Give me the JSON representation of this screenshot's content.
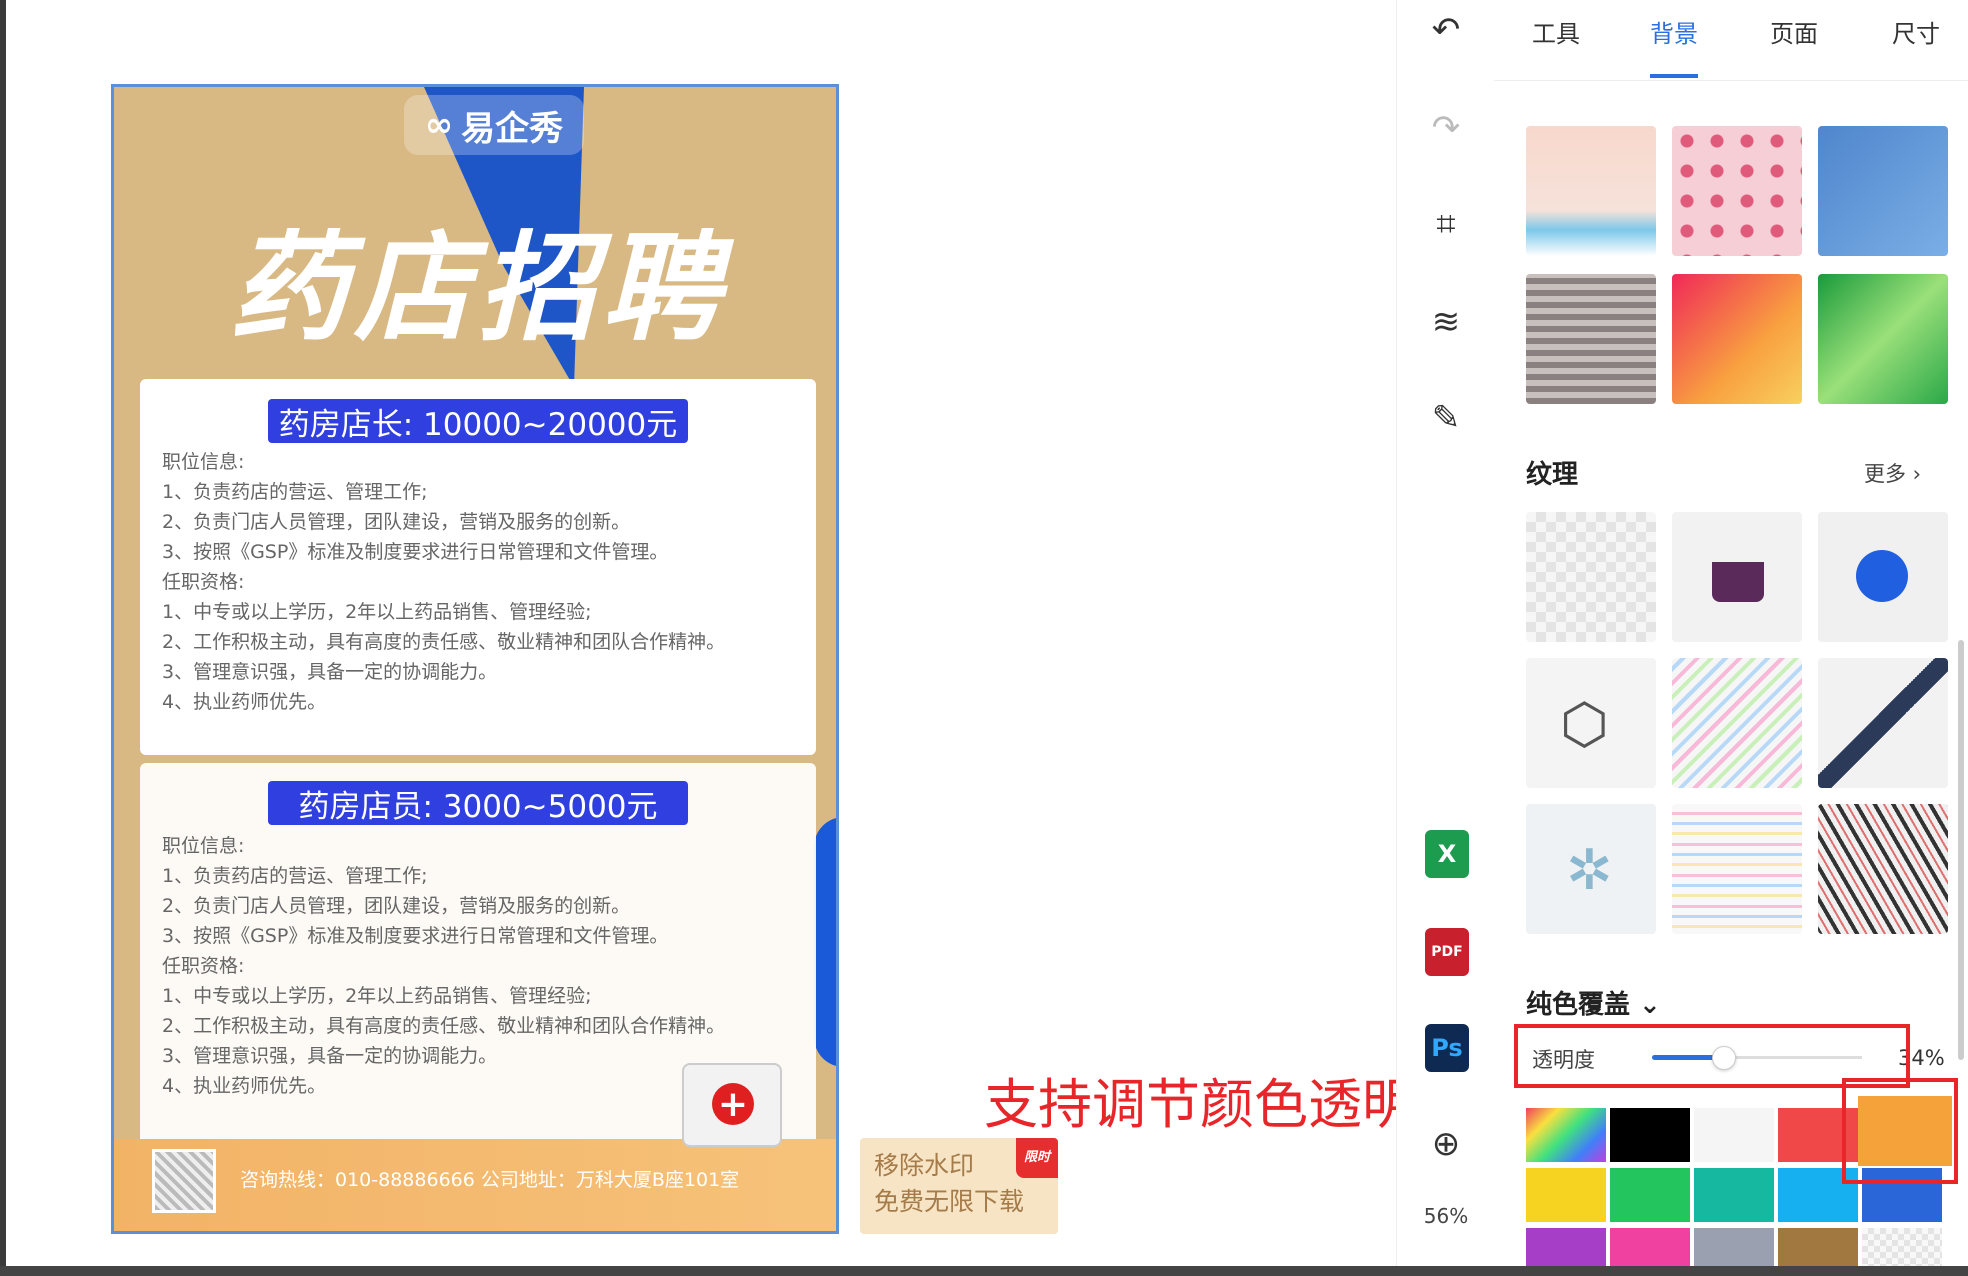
{
  "poster": {
    "logo_text": "易企秀",
    "title": "药店招聘",
    "job1": {
      "salary": "药房店长: 10000~20000元",
      "lines": [
        "职位信息:",
        "1、负责药店的营运、管理工作;",
        "2、负责门店人员管理，团队建设，营销及服务的创新。",
        "3、按照《GSP》标准及制度要求进行日常管理和文件管理。",
        "任职资格:",
        "1、中专或以上学历，2年以上药品销售、管理经验;",
        "2、工作积极主动，具有高度的责任感、敬业精神和团队合作精神。",
        "3、管理意识强，具备一定的协调能力。",
        "4、执业药师优先。"
      ]
    },
    "job2": {
      "salary": "药房店员: 3000~5000元",
      "lines": [
        "职位信息:",
        "1、负责药店的营运、管理工作;",
        "2、负责门店人员管理，团队建设，营销及服务的创新。",
        "3、按照《GSP》标准及制度要求进行日常管理和文件管理。",
        "任职资格:",
        "1、中专或以上学历，2年以上药品销售、管理经验;",
        "2、工作积极主动，具有高度的责任感、敬业精神和团队合作精神。",
        "3、管理意识强，具备一定的协调能力。",
        "4、执业药师优先。"
      ]
    },
    "hotline": "咨询热线：010-88886666 公司地址：万科大厦B座101室"
  },
  "watermark": {
    "tag": "限时",
    "line1": "移除水印",
    "line2": "免费无限下载"
  },
  "annotation": "支持调节颜色透明度",
  "toolbar": {
    "undo_icon": "↶",
    "redo_icon": "↷",
    "crop_icon": "⌗",
    "layers_icon": "≋",
    "brush_icon": "✎",
    "excel_label": "X",
    "pdf_label": "PDF",
    "ps_label": "Ps",
    "zoom_icon": "⊕",
    "zoom_level": "56%"
  },
  "panel": {
    "tabs": [
      "工具",
      "背景",
      "页面",
      "尺寸"
    ],
    "active_tab": "背景",
    "texture_title": "纹理",
    "more_label": "更多 ›",
    "solid_title": "纯色覆盖 ⌄",
    "opacity_label": "透明度",
    "opacity_value": "34%",
    "opacity_fraction": 0.34,
    "swatch_colors": [
      "rainbow",
      "#000000",
      "#f5f5f5",
      "#f04848",
      "#f5a23a",
      "#f5d320",
      "#22c55e",
      "#16b8a0",
      "#16b0f0",
      "#2a66d8",
      "#a63ec8",
      "#f040a0",
      "#9aa0b0",
      "#a07840",
      "#f4f4f4"
    ]
  }
}
